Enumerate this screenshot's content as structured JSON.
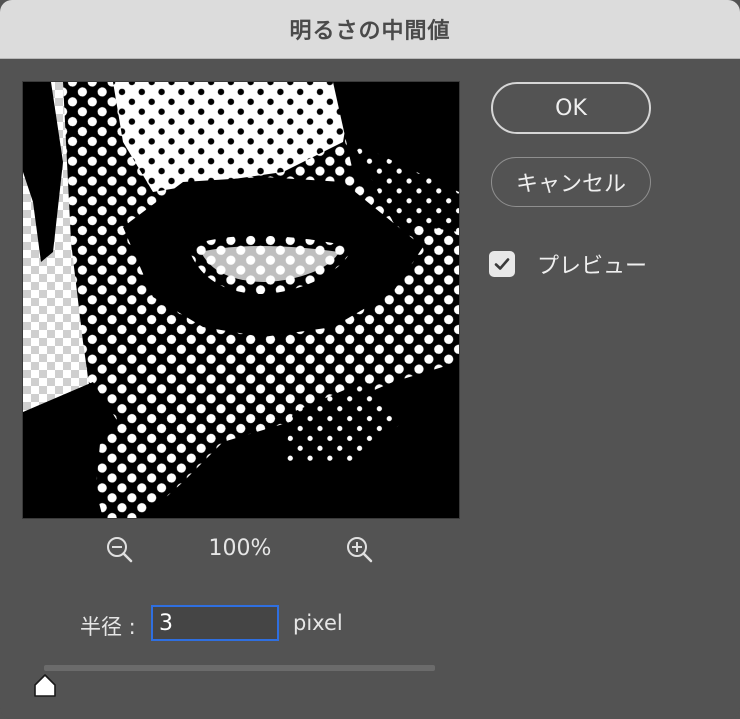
{
  "window": {
    "title": "明るさの中間値"
  },
  "preview": {
    "zoom_level": "100%"
  },
  "radius": {
    "label": "半径 :",
    "value": "3",
    "unit": "pixel"
  },
  "buttons": {
    "ok_label": "OK",
    "cancel_label": "キャンセル"
  },
  "preview_toggle": {
    "label": "プレビュー",
    "checked": true
  },
  "slider": {
    "fraction": 0.0
  },
  "colors": {
    "accent": "#2f6fe0",
    "dialog_bg": "#535353",
    "titlebar_bg": "#dcdcdc"
  },
  "icons": {
    "zoom_out": "zoom-out-icon",
    "zoom_in": "zoom-in-icon",
    "checkmark": "checkmark-icon",
    "slider_thumb": "slider-thumb-icon"
  }
}
